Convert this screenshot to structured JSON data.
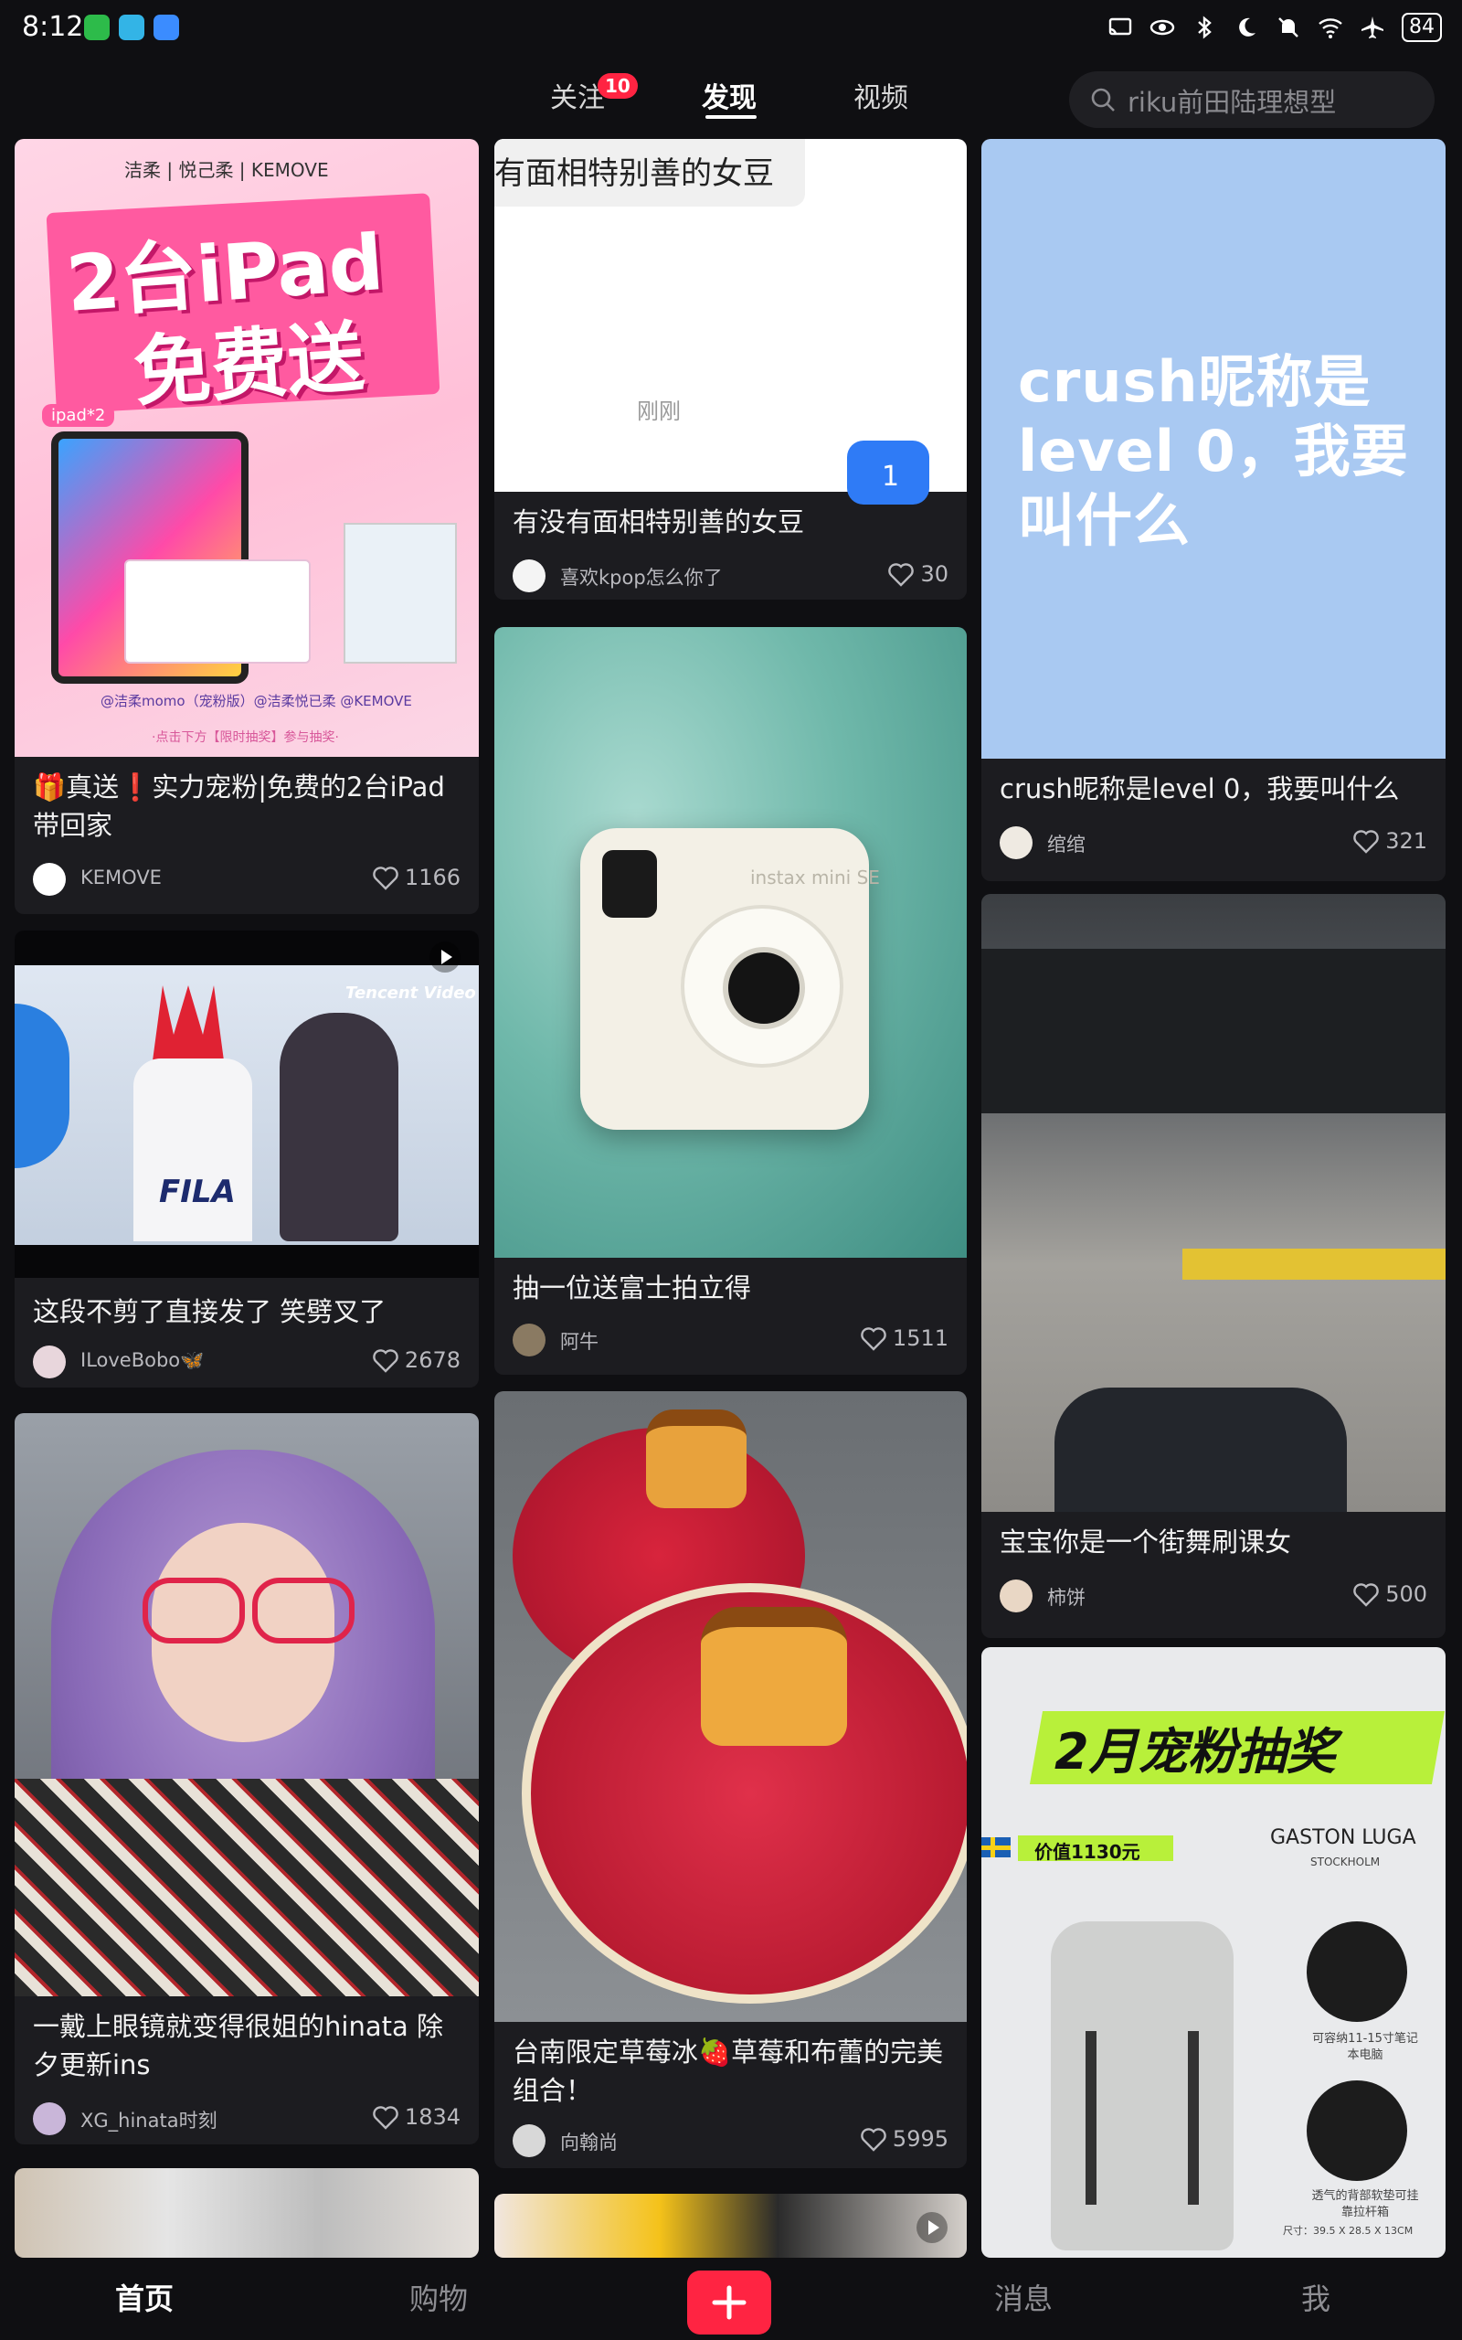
{
  "status_bar": {
    "time": "8:12",
    "apps": [
      "wechat-icon",
      "download-icon",
      "cloud-icon"
    ],
    "battery": "84"
  },
  "header": {
    "tabs": [
      {
        "label": "关注",
        "badge": "10"
      },
      {
        "label": "发现",
        "active": true
      },
      {
        "label": "视频"
      }
    ],
    "search_placeholder": "riku前田陆理想型"
  },
  "feed": {
    "col1": [
      {
        "title": "🎁真送❗️实力宠粉|免费的2台iPad带回家",
        "author": "KEMOVE",
        "likes": "1166",
        "thumb_text": {
          "line1": "2台iPad",
          "line2": "免费送",
          "brand": "洁柔 | 悦己柔 | KEMOVE",
          "tag": "ipad*2",
          "bottom": "@洁柔momo（宠粉版）@洁柔悦已柔 @KEMOVE",
          "footer": "·点击下方【限时抽奖】参与抽奖·"
        }
      },
      {
        "title": "这段不剪了直接发了 笑劈叉了",
        "author": "ILoveBobo🦋",
        "likes": "2678",
        "thumb_text": {
          "watermark": "Tencent Video",
          "shirt": "FILA"
        }
      },
      {
        "title": "一戴上眼镜就变得很姐的hinata 除夕更新ins",
        "author": "XG_hinata时刻",
        "likes": "1834"
      }
    ],
    "col2": [
      {
        "title": "有没有面相特别善的女豆",
        "author": "喜欢kpop怎么你了",
        "likes": "30",
        "thumb_text": {
          "chat": "有面相特别善的女豆",
          "time": "刚刚",
          "bubble": "1"
        }
      },
      {
        "title": "抽一位送富士拍立得",
        "author": "阿牛",
        "likes": "1511",
        "thumb_text": {
          "camera": "instax mini SE"
        }
      },
      {
        "title": "台南限定草莓冰🍓草莓和布蕾的完美组合！",
        "author": "向翰尚",
        "likes": "5995"
      }
    ],
    "col3": [
      {
        "title": "crush昵称是level 0，我要叫什么",
        "author": "绾绾",
        "likes": "321",
        "thumb_text": {
          "big": "crush昵称是level 0，我要叫什么"
        }
      },
      {
        "title": "宝宝你是一个街舞刷课女",
        "author": "柿饼",
        "likes": "500"
      },
      {
        "thumb_text": {
          "headline": "2月宠粉抽奖",
          "price": "价值1130元",
          "brand": "GASTON LUGA",
          "brand_sub": "STOCKHOLM",
          "feat1": "可容纳11-15寸笔记本电脑",
          "feat2": "透气的背部软垫可挂靠拉杆箱",
          "size": "尺寸：39.5 X 28.5 X 13CM"
        }
      }
    ]
  },
  "bottom_nav": {
    "items": [
      {
        "label": "首页",
        "active": true
      },
      {
        "label": "购物"
      },
      {
        "label": "消息"
      },
      {
        "label": "我"
      }
    ]
  },
  "colors": {
    "accent": "#ff2442",
    "background": "#0f0f12",
    "card": "#1c1c20"
  }
}
